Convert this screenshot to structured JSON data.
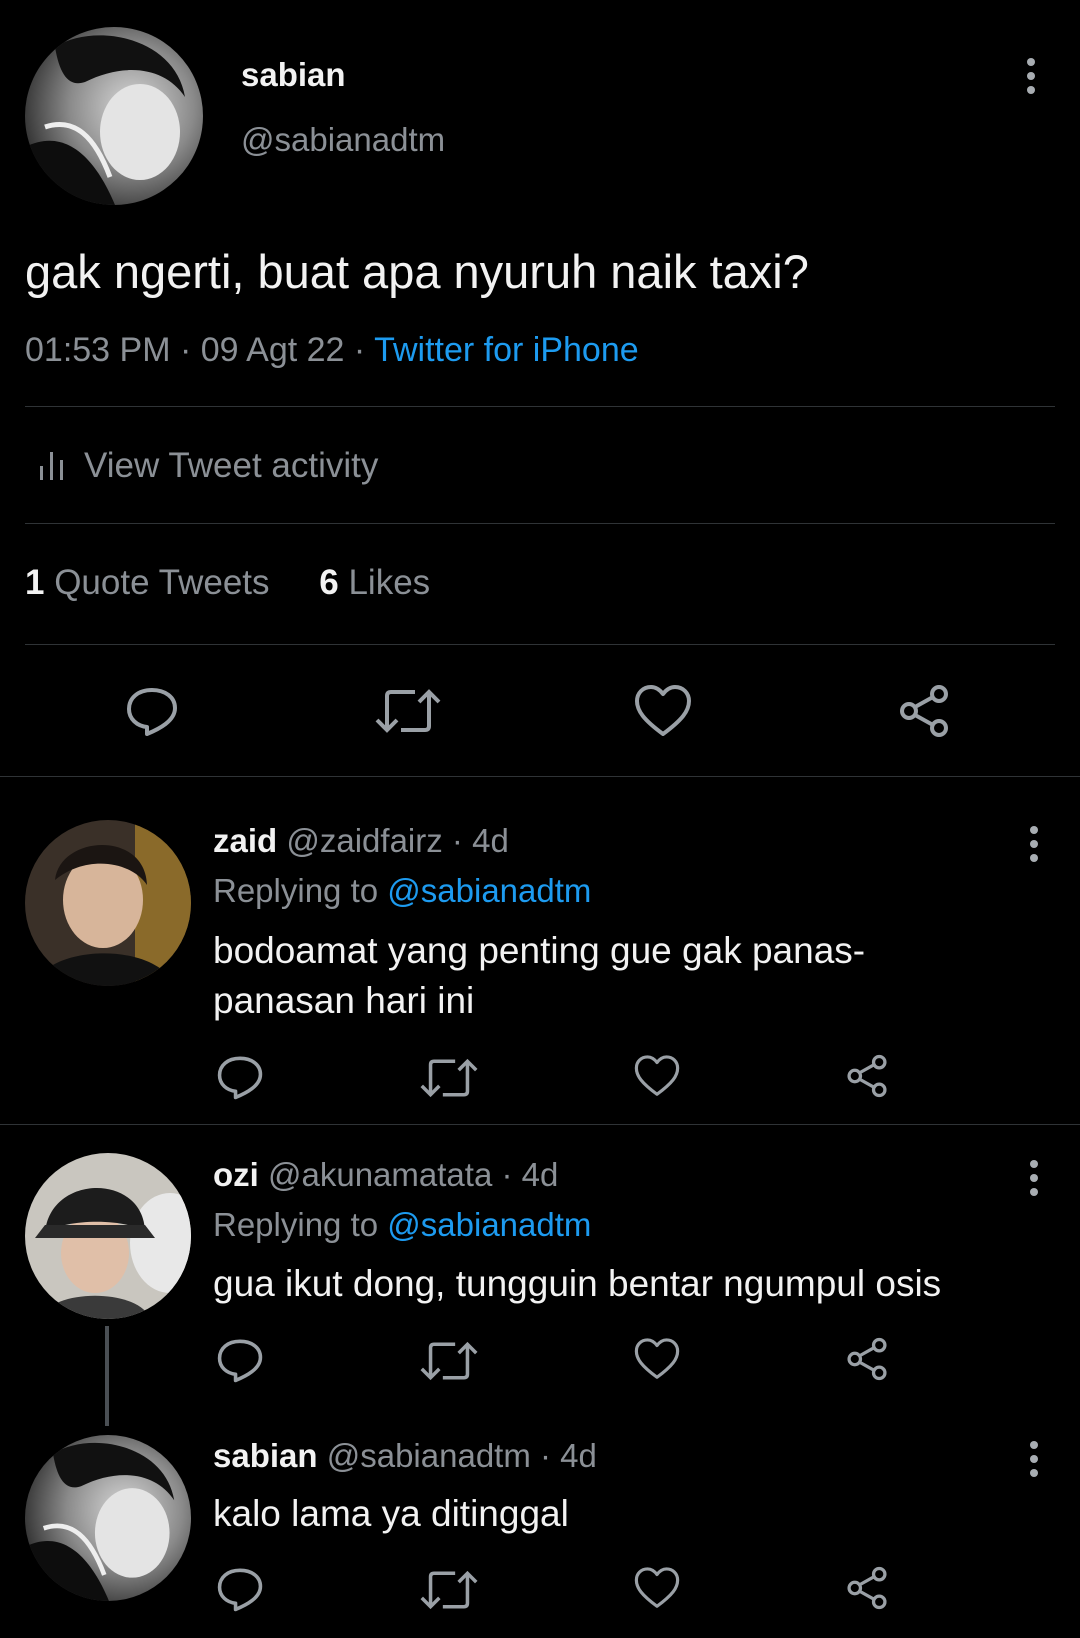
{
  "main_tweet": {
    "display_name": "sabian",
    "handle": "@sabianadtm",
    "text": "gak ngerti, buat apa nyuruh naik taxi?",
    "time": "01:53 PM",
    "date": "09 Agt 22",
    "source": "Twitter for iPhone",
    "activity_label": "View Tweet activity",
    "quote_count": "1",
    "quote_label": "Quote Tweets",
    "like_count": "6",
    "like_label": "Likes"
  },
  "replies": [
    {
      "display_name": "zaid",
      "handle": "@zaidfairz",
      "age": "4d",
      "replying_label": "Replying to",
      "replying_to": "@sabianadtm",
      "text_line1": "bodoamat yang penting gue gak panas-",
      "text_line2": "panasan hari ini"
    },
    {
      "display_name": "ozi",
      "handle": "@akunamatata",
      "age": "4d",
      "replying_label": "Replying to",
      "replying_to": "@sabianadtm",
      "text_line1": "gua ikut dong, tungguin bentar ngumpul osis"
    },
    {
      "display_name": "sabian",
      "handle": "@sabianadtm",
      "age": "4d",
      "text_line1": "kalo lama ya ditinggal"
    }
  ],
  "separator": "·",
  "icons": {
    "more": "more-vertical-icon",
    "reply": "reply-icon",
    "retweet": "retweet-icon",
    "like": "heart-icon",
    "share": "share-icon",
    "activity": "bar-chart-icon"
  },
  "colors": {
    "background": "#000000",
    "text": "#e7e9ea",
    "secondary": "#8b9096",
    "link": "#1d9bf0",
    "divider": "#2f3336"
  }
}
